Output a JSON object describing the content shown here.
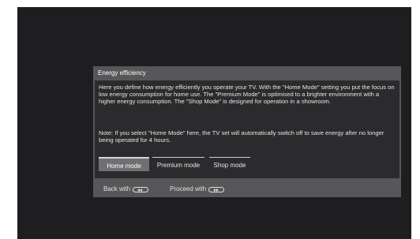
{
  "dialog": {
    "title": "Energy efficiency",
    "paragraph_1": "Here you define how energy efficiently you operate your TV. With the  \"Home Mode\" setting you put the focus on low energy consumption for home use. The \"Premium Mode\" is optimised to a brighter environment with a higher energy consumption. The \"Shop Mode\" is designed for operation in a showroom.",
    "paragraph_2": "Note: If you select  \"Home Mode\" here, the TV set will automatically switch off to save energy after no longer being operated for 4 hours."
  },
  "modes": {
    "selected": "Home mode",
    "items": [
      {
        "label": "Home mode"
      },
      {
        "label": "Premium mode"
      },
      {
        "label": "Shop mode"
      }
    ]
  },
  "footer": {
    "back_label": "Back with",
    "back_icon": "remote-back-button-icon",
    "proceed_label": "Proceed with",
    "proceed_icon": "remote-forward-button-icon"
  },
  "colors": {
    "screen_background": "#1e1d1f",
    "dialog_background": "#575658",
    "content_background": "#2b2a2c",
    "selected_mode_background": "#707072"
  }
}
